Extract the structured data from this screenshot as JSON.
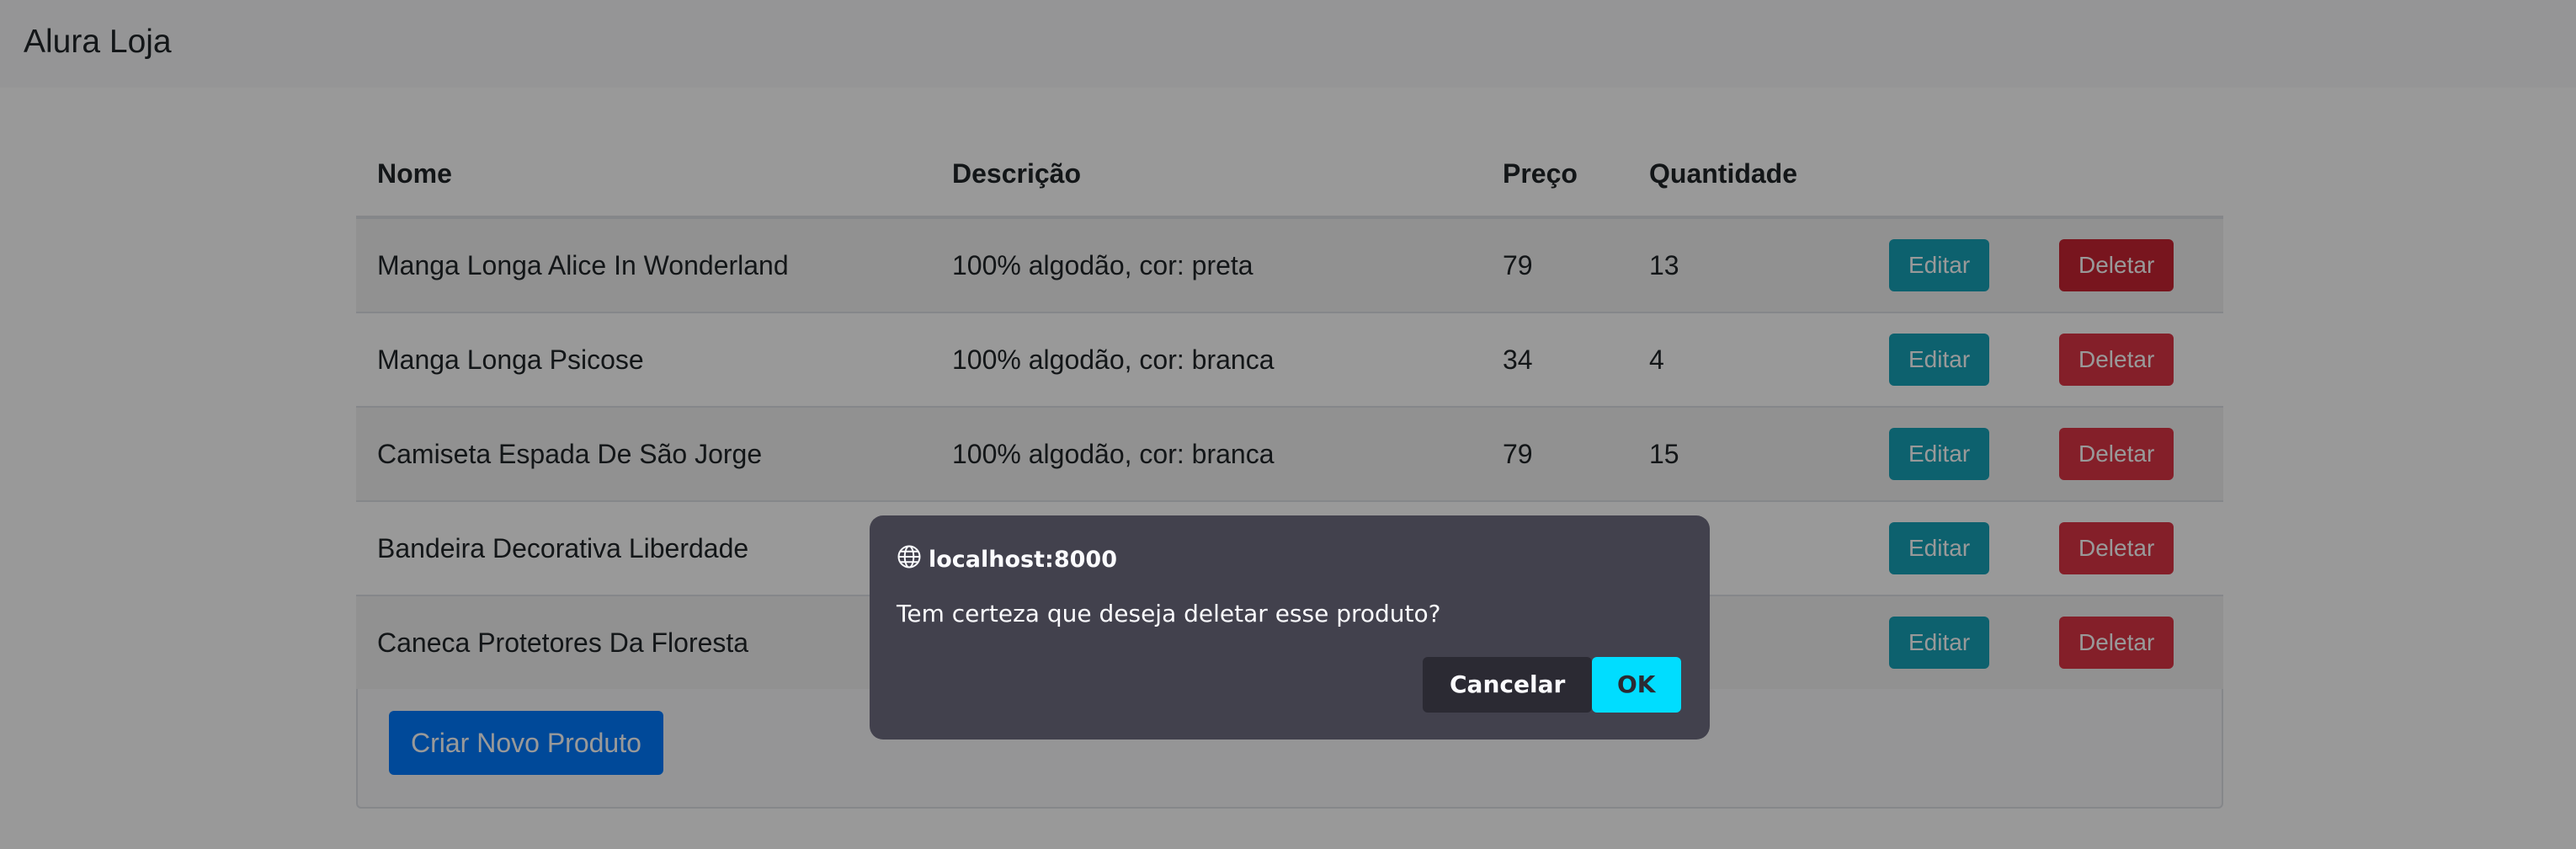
{
  "navbar": {
    "brand": "Alura Loja"
  },
  "table": {
    "headers": [
      "Nome",
      "Descrição",
      "Preço",
      "Quantidade"
    ],
    "rows": [
      {
        "nome": "Manga Longa Alice In Wonderland",
        "descricao": "100% algodão, cor: preta",
        "preco": "79",
        "quantidade": "13"
      },
      {
        "nome": "Manga Longa Psicose",
        "descricao": "100% algodão, cor: branca",
        "preco": "34",
        "quantidade": "4"
      },
      {
        "nome": "Camiseta Espada De São Jorge",
        "descricao": "100% algodão, cor: branca",
        "preco": "79",
        "quantidade": "15"
      },
      {
        "nome": "Bandeira Decorativa Liberdade",
        "descricao": "",
        "preco": "",
        "quantidade": ""
      },
      {
        "nome": "Caneca Protetores Da Floresta",
        "descricao": "",
        "preco": "",
        "quantidade": ""
      }
    ],
    "edit_label": "Editar",
    "delete_label": "Deletar"
  },
  "create_button": "Criar Novo Produto",
  "dialog": {
    "origin": "localhost:8000",
    "message": "Tem certeza que deseja deletar esse produto?",
    "cancel_label": "Cancelar",
    "ok_label": "OK"
  },
  "colors": {
    "info": "#17a2b8",
    "danger": "#dc3545",
    "primary": "#007bff",
    "dialog_bg": "#42414d",
    "ok": "#00ddff"
  }
}
